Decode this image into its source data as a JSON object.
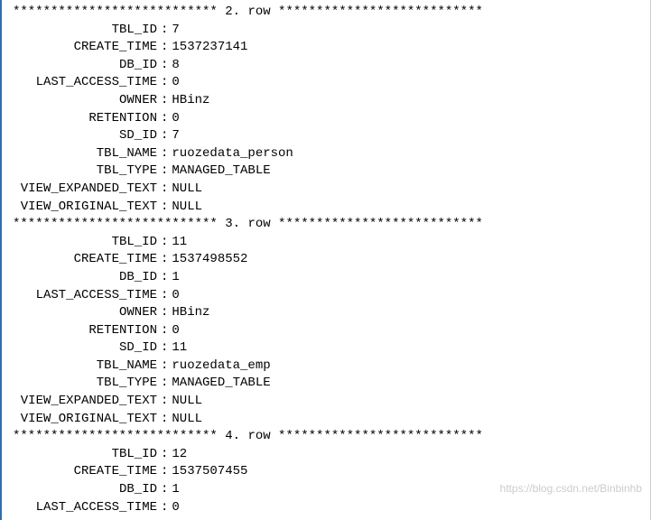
{
  "rows": [
    {
      "separator": "*************************** 2. row ***************************",
      "fields": [
        {
          "label": "TBL_ID",
          "value": "7"
        },
        {
          "label": "CREATE_TIME",
          "value": "1537237141"
        },
        {
          "label": "DB_ID",
          "value": "8"
        },
        {
          "label": "LAST_ACCESS_TIME",
          "value": "0"
        },
        {
          "label": "OWNER",
          "value": "HBinz"
        },
        {
          "label": "RETENTION",
          "value": "0"
        },
        {
          "label": "SD_ID",
          "value": "7"
        },
        {
          "label": "TBL_NAME",
          "value": "ruozedata_person"
        },
        {
          "label": "TBL_TYPE",
          "value": "MANAGED_TABLE"
        },
        {
          "label": "VIEW_EXPANDED_TEXT",
          "value": "NULL"
        },
        {
          "label": "VIEW_ORIGINAL_TEXT",
          "value": "NULL"
        }
      ]
    },
    {
      "separator": "*************************** 3. row ***************************",
      "fields": [
        {
          "label": "TBL_ID",
          "value": "11"
        },
        {
          "label": "CREATE_TIME",
          "value": "1537498552"
        },
        {
          "label": "DB_ID",
          "value": "1"
        },
        {
          "label": "LAST_ACCESS_TIME",
          "value": "0"
        },
        {
          "label": "OWNER",
          "value": "HBinz"
        },
        {
          "label": "RETENTION",
          "value": "0"
        },
        {
          "label": "SD_ID",
          "value": "11"
        },
        {
          "label": "TBL_NAME",
          "value": "ruozedata_emp"
        },
        {
          "label": "TBL_TYPE",
          "value": "MANAGED_TABLE"
        },
        {
          "label": "VIEW_EXPANDED_TEXT",
          "value": "NULL"
        },
        {
          "label": "VIEW_ORIGINAL_TEXT",
          "value": "NULL"
        }
      ]
    },
    {
      "separator": "*************************** 4. row ***************************",
      "fields": [
        {
          "label": "TBL_ID",
          "value": "12"
        },
        {
          "label": "CREATE_TIME",
          "value": "1537507455"
        },
        {
          "label": "DB_ID",
          "value": "1"
        },
        {
          "label": "LAST_ACCESS_TIME",
          "value": "0"
        }
      ]
    }
  ],
  "watermark": "https://blog.csdn.net/Binbinhb"
}
